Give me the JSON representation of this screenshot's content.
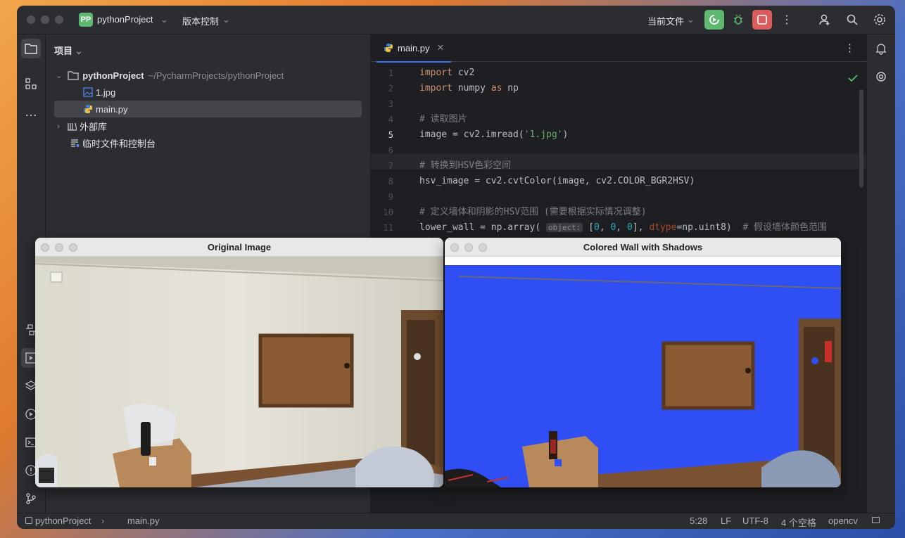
{
  "titlebar": {
    "project_badge": "PP",
    "project_name": "pythonProject",
    "vcs_label": "版本控制",
    "run_config": "当前文件"
  },
  "project_panel": {
    "title": "项目",
    "root_name": "pythonProject",
    "root_path": "~/PycharmProjects/pythonProject",
    "files": [
      "1.jpg",
      "main.py"
    ],
    "external_libs": "外部库",
    "scratches": "临时文件和控制台"
  },
  "editor": {
    "tab_label": "main.py",
    "line_numbers": [
      "1",
      "2",
      "3",
      "4",
      "5",
      "6",
      "7",
      "8",
      "9",
      "10",
      "11"
    ],
    "hint_object": "object:"
  },
  "statusbar": {
    "project": "pythonProject",
    "file": "main.py",
    "position": "5:28",
    "line_sep": "LF",
    "encoding": "UTF-8",
    "indent": "4 个空格",
    "interpreter": "opencv"
  },
  "windows": {
    "original_title": "Original Image",
    "colored_title": "Colored Wall with Shadows"
  },
  "colors": {
    "accent": "#3574f0",
    "run_green": "#5fb86f",
    "stop_red": "#db5c5c",
    "wall_blue": "#2f4ff5"
  },
  "icons": [
    "folder-icon",
    "structure-icon",
    "more-icon",
    "python-console-icon",
    "run-icon",
    "layers-icon",
    "services-icon",
    "terminal-icon",
    "problems-icon",
    "git-icon",
    "bell-icon",
    "ai-icon",
    "search-icon",
    "settings-icon",
    "add-user-icon",
    "debug-icon",
    "stop-icon"
  ]
}
